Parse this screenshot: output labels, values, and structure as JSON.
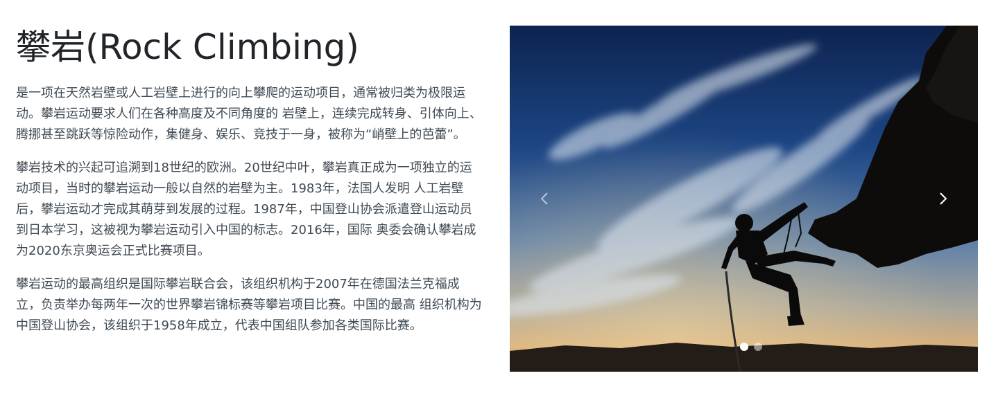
{
  "header": {
    "title": "攀岩(Rock Climbing)"
  },
  "content": {
    "paragraphs": [
      "是一项在天然岩壁或人工岩壁上进行的向上攀爬的运动项目，通常被归类为极限运动。攀岩运动要求人们在各种高度及不同角度的 岩壁上，连续完成转身、引体向上、腾挪甚至跳跃等惊险动作，集健身、娱乐、竞技于一身，被称为“峭壁上的芭蕾”。",
      "攀岩技术的兴起可追溯到18世纪的欧洲。20世纪中叶，攀岩真正成为一项独立的运动项目，当时的攀岩运动一般以自然的岩壁为主。1983年，法国人发明 人工岩壁后，攀岩运动才完成其萌芽到发展的过程。1987年，中国登山协会派遣登山运动员到日本学习，这被视为攀岩运动引入中国的标志。2016年，国际 奥委会确认攀岩成为2020东京奥运会正式比赛项目。",
      "攀岩运动的最高组织是国际攀岩联合会，该组织机构于2007年在德国法兰克福成立，负责举办每两年一次的世界攀岩锦标赛等攀岩项目比赛。中国的最高 组织机构为中国登山协会，该组织于1958年成立，代表中国组队参加各类国际比赛。"
    ]
  },
  "carousel": {
    "prev_icon": "chevron-left-icon",
    "next_icon": "chevron-right-icon",
    "slide_count": 2,
    "active_index": 0
  },
  "colors": {
    "title": "#212529",
    "body_text": "#3f4a54",
    "sky_top": "#0d2350",
    "indicator": "#ffffff"
  }
}
